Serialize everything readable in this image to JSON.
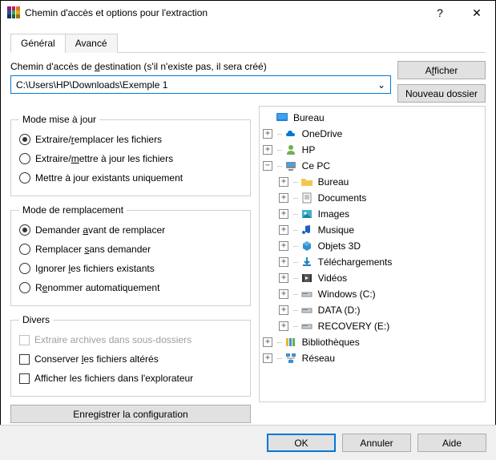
{
  "title": "Chemin d'accès et options pour l'extraction",
  "tabs": {
    "general": "Général",
    "advanced": "Avancé"
  },
  "path_label_pre": "Chemin d'accès de ",
  "path_label_u": "d",
  "path_label_post": "estination (s'il n'existe pas, il sera créé)",
  "path_value": "C:\\Users\\HP\\Downloads\\Exemple 1",
  "btn_show_pre": "A",
  "btn_show_u": "f",
  "btn_show_post": "ficher",
  "btn_newfolder": "Nouveau dossier",
  "grp_update": "Mode mise à jour",
  "radio_extract_replace_pre": "Extraire/",
  "radio_extract_replace_u": "r",
  "radio_extract_replace_post": "emplacer les fichiers",
  "radio_extract_update_pre": "Extraire/",
  "radio_extract_update_u": "m",
  "radio_extract_update_post": "ettre à jour les fichiers",
  "radio_update_existing_pre": "Mettre à ",
  "radio_update_existing_u": "j",
  "radio_update_existing_post": "our existants uniquement",
  "grp_overwrite": "Mode de remplacement",
  "radio_ask_pre": "Demander ",
  "radio_ask_u": "a",
  "radio_ask_post": "vant de remplacer",
  "radio_replace_pre": "Remplacer ",
  "radio_replace_u": "s",
  "radio_replace_post": "ans demander",
  "radio_skip_pre": "Ignorer ",
  "radio_skip_u": "l",
  "radio_skip_post": "es fichiers existants",
  "radio_rename_pre": "R",
  "radio_rename_u": "e",
  "radio_rename_post": "nommer automatiquement",
  "grp_misc": "Divers",
  "chk_subfolders": "Extraire archives dans sous-dossiers",
  "chk_broken_pre": "Conserver ",
  "chk_broken_u": "l",
  "chk_broken_post": "es fichiers altérés",
  "chk_explorer": "Afficher les fichiers dans l'explorateur",
  "btn_save": "Enregistrer la configuration",
  "tree": {
    "desktop": "Bureau",
    "onedrive": "OneDrive",
    "hp": "HP",
    "thispc": "Ce PC",
    "pc_desktop": "Bureau",
    "pc_documents": "Documents",
    "pc_images": "Images",
    "pc_music": "Musique",
    "pc_3d": "Objets 3D",
    "pc_downloads": "Téléchargements",
    "pc_videos": "Vidéos",
    "pc_c": "Windows (C:)",
    "pc_d": "DATA (D:)",
    "pc_e": "RECOVERY (E:)",
    "libraries": "Bibliothèques",
    "network": "Réseau"
  },
  "btn_ok": "OK",
  "btn_cancel": "Annuler",
  "btn_help": "Aide"
}
